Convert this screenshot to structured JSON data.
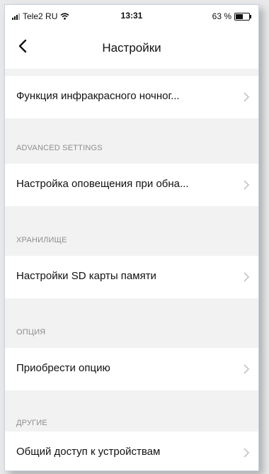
{
  "status_bar": {
    "carrier": "Tele2 RU",
    "time": "13:31",
    "battery_percent_label": "63 %",
    "battery_level": 0.63,
    "icons": [
      "signal-icon",
      "wifi-icon",
      "battery-icon"
    ]
  },
  "nav": {
    "title": "Настройки",
    "back_icon": "chevron-left-icon"
  },
  "rows": [
    {
      "label": "Функция инфракрасного ночног..."
    },
    {
      "header": "ADVANCED SETTINGS",
      "label": "Настройка оповещения при обна..."
    },
    {
      "header": "ХРАНИЛИЩЕ",
      "label": "Настройки SD карты памяти"
    },
    {
      "header": "ОПЦИЯ",
      "label": "Приобрести опцию"
    },
    {
      "header": "ДРУГИЕ",
      "label": "Общий доступ к устройствам"
    }
  ],
  "colors": {
    "background": "#f2f2f2",
    "row_background": "#ffffff",
    "section_text": "#8e8e93",
    "chevron": "#c7c7cc"
  }
}
